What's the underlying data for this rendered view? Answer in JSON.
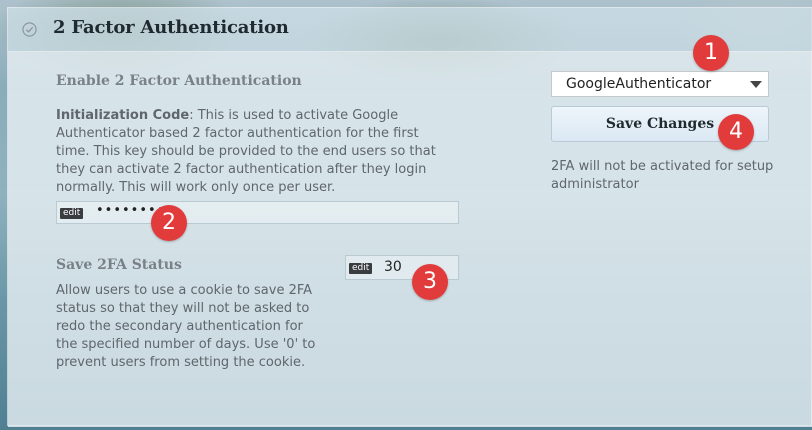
{
  "section": {
    "title": "2 Factor Authentication",
    "icon": "check-circle-icon"
  },
  "enable": {
    "label": "Enable 2 Factor Authentication",
    "select_value": "GoogleAuthenticator"
  },
  "init_code": {
    "term": "Initialization Code",
    "description": ": This is used to activate Google Authenticator based 2 factor authentication for the first time. This key should be provided to the end users so that they can activate 2 factor authentication after they login normally. This will work only once per user.",
    "edit_tag": "edit",
    "value": "••••••••"
  },
  "save_status": {
    "label": "Save 2FA Status",
    "description": "Allow users to use a cookie to save 2FA status so that they will not be asked to redo the secondary authentication for the specified number of days. Use '0' to prevent users from setting the cookie.",
    "edit_tag": "edit",
    "value": "30"
  },
  "actions": {
    "save_label": "Save Changes",
    "note": "2FA will not be activated for setup administrator"
  },
  "badges": [
    "1",
    "2",
    "3",
    "4"
  ],
  "colors": {
    "badge": "#e23b3b",
    "header_bg": "#cddee5"
  }
}
